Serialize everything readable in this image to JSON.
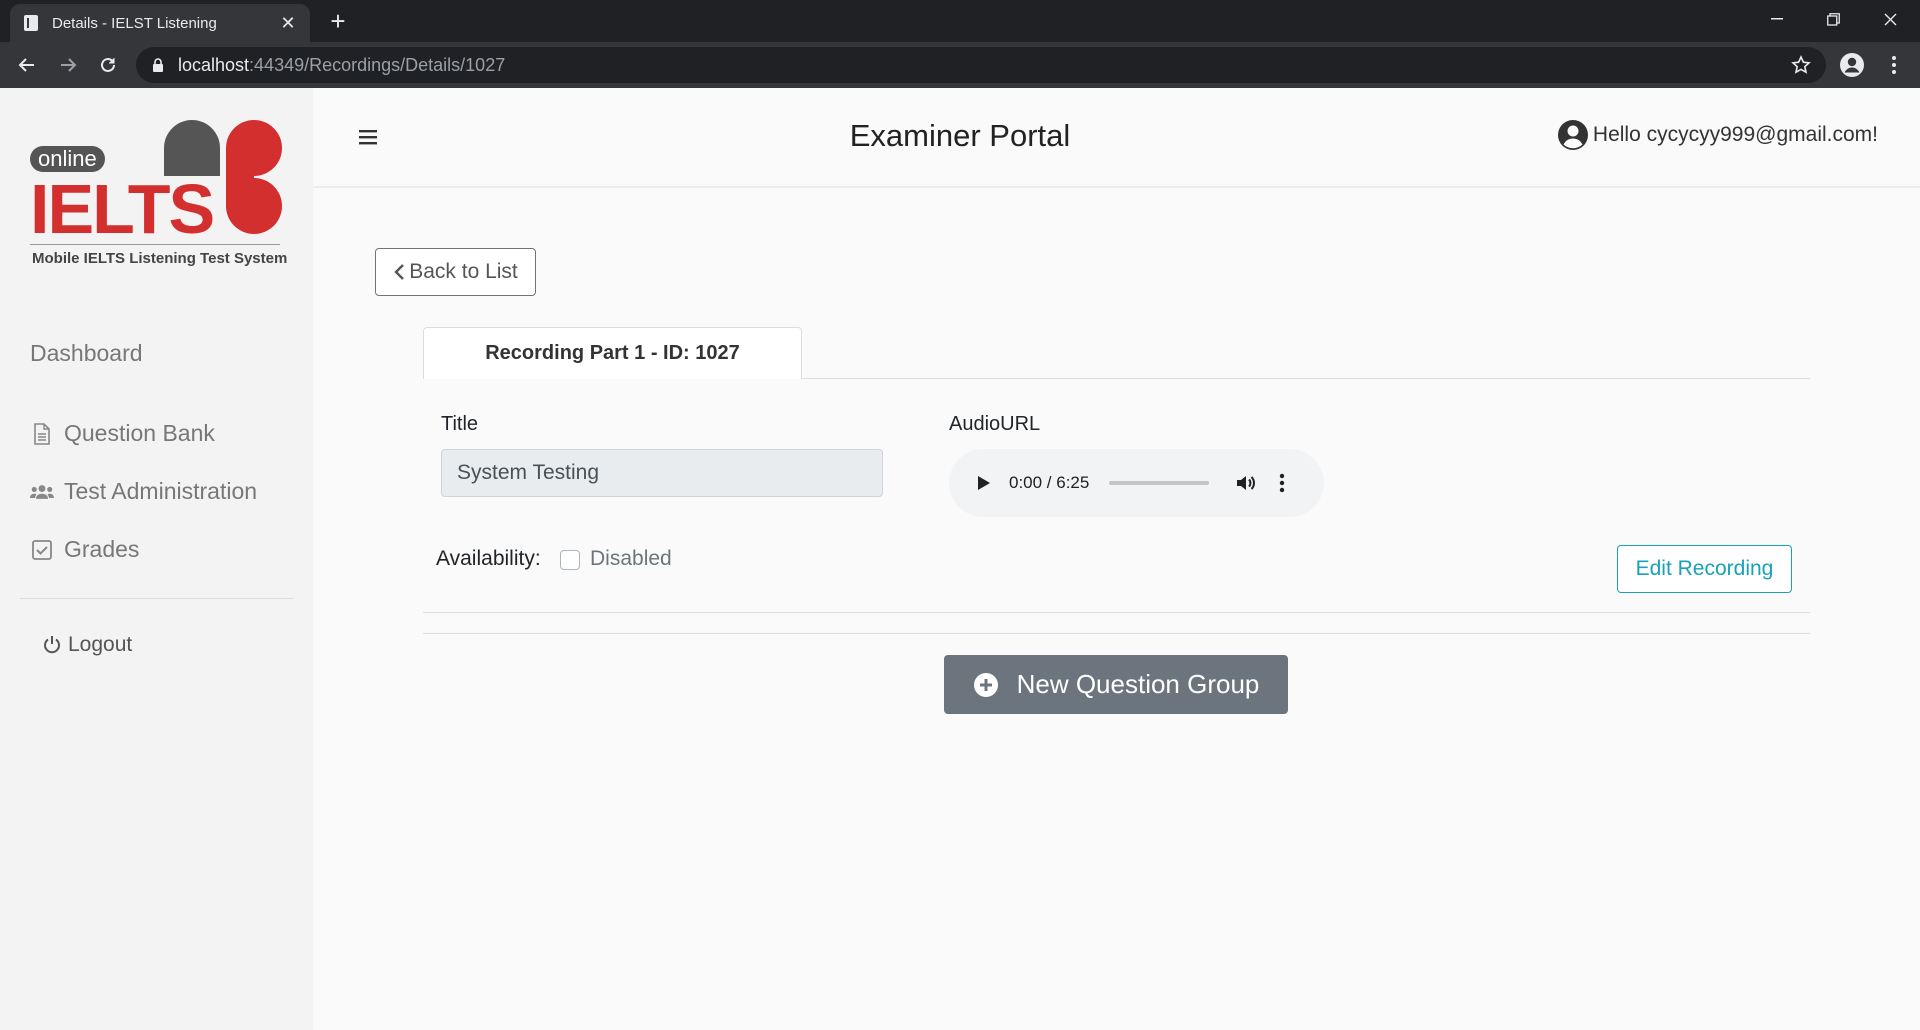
{
  "browser": {
    "tab_title": "Details - IELST Listening",
    "url_host": "localhost",
    "url_path": ":44349/Recordings/Details/1027"
  },
  "logo": {
    "online": "online",
    "brand": "IELTS",
    "tagline": "Mobile IELTS Listening Test System",
    "colors": {
      "red": "#d32f2f",
      "gray": "#555555"
    }
  },
  "sidebar": {
    "items": [
      {
        "label": "Dashboard",
        "icon": "none"
      },
      {
        "label": "Question Bank",
        "icon": "document-icon"
      },
      {
        "label": "Test Administration",
        "icon": "users-icon"
      },
      {
        "label": "Grades",
        "icon": "checkbox-icon"
      },
      {
        "label": "Logout",
        "icon": "power-icon"
      }
    ]
  },
  "header": {
    "title": "Examiner Portal",
    "greeting": "Hello cycycyy999@gmail.com!"
  },
  "content": {
    "back_label": "Back to List",
    "tab_label": "Recording Part 1 - ID: 1027",
    "title_label": "Title",
    "title_value": "System Testing",
    "audio_label": "AudioURL",
    "audio_time": "0:00 / 6:25",
    "audio_progress": 0,
    "availability_label": "Availability:",
    "availability_checked": false,
    "availability_value": "Disabled",
    "edit_label": "Edit Recording",
    "new_group_label": "New Question Group",
    "colors": {
      "info": "#17a2b8",
      "secondary": "#6c757d"
    }
  }
}
